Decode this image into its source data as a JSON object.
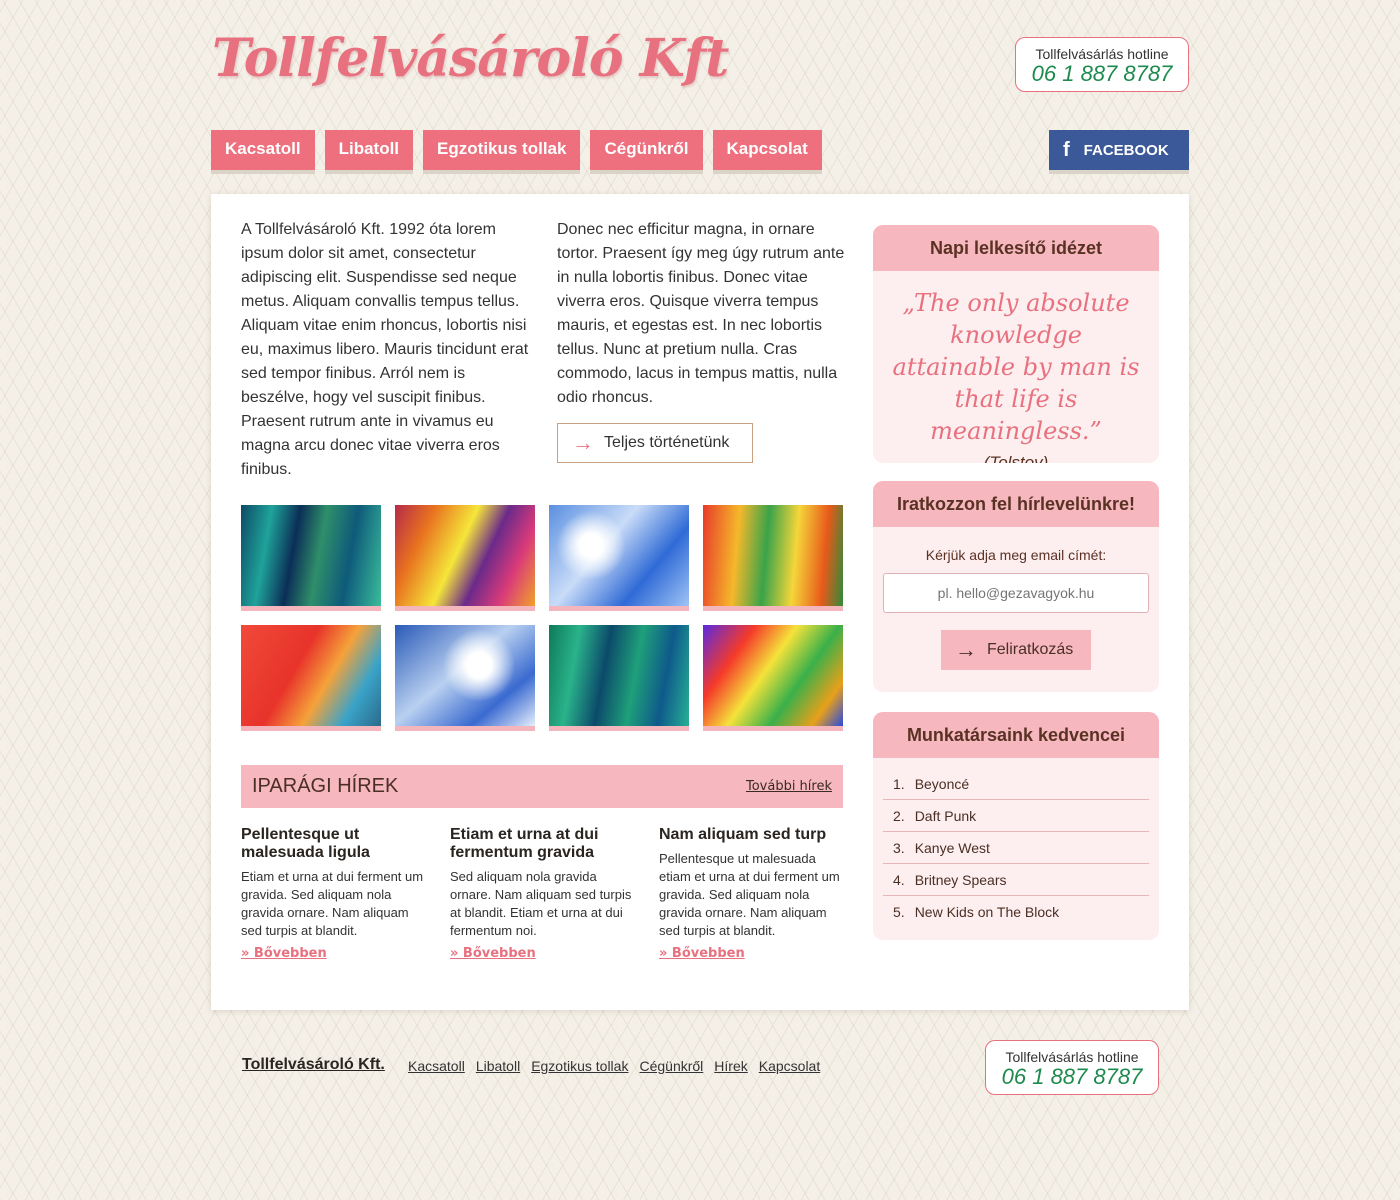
{
  "header": {
    "logo": "Tollfelvásároló Kft",
    "hotline_label": "Tollfelvásárlás hotline",
    "hotline_number": "06 1 887 8787"
  },
  "nav": [
    "Kacsatoll",
    "Libatoll",
    "Egzotikus tollak",
    "Cégünkről",
    "Kapcsolat"
  ],
  "facebook": {
    "icon": "facebook-icon",
    "label": "FACEBOOK",
    "color": "#3b5998"
  },
  "intro": {
    "col1": "A Tollfelvásároló Kft. 1992 óta lorem ipsum dolor sit amet, consectetur adipiscing elit. Suspendisse sed neque metus. Aliquam convallis tempus tellus. Aliquam vitae enim rhoncus, lobortis nisi eu, maximus libero. Mauris tincidunt erat sed tempor finibus. Arról nem is beszélve, hogy vel suscipit finibus. Praesent rutrum ante in vivamus eu magna arcu donec vitae viverra eros finibus.",
    "col2": "Donec nec efficitur magna, in ornare tortor. Praesent így meg úgy rutrum ante in nulla lobortis finibus. Donec vitae viverra eros. Quisque viverra tempus mauris, et egestas est. In nec lobortis tellus. Nunc at pretium nulla. Cras commodo, lacus in tempus mattis, nulla odio rhoncus.",
    "button": "Teljes történetünk"
  },
  "news_header": {
    "title": "IPARÁGI HÍREK",
    "more": "További hírek"
  },
  "news": [
    {
      "title": "Pellentesque ut malesuada ligula",
      "body": "Etiam et urna at dui ferment um gravida. Sed aliquam nola gravida ornare. Nam aliquam sed turpis at blandit.",
      "more": "» Bővebben"
    },
    {
      "title": "Etiam et urna at dui fermentum gravida",
      "body": "Sed aliquam nola gravida ornare. Nam aliquam sed turpis at blandit. Etiam et urna at dui fermentum noi.",
      "more": "» Bővebben"
    },
    {
      "title": "Nam aliquam sed turp",
      "body": "Pellentesque ut malesuada etiam et urna at dui ferment um gravida. Sed aliquam nola gravida ornare. Nam aliquam sed turpis at blandit.",
      "more": "» Bővebben"
    }
  ],
  "quote": {
    "title": "Napi lelkesítő idézet",
    "text": "„The only absolute knowledge attainable by man is that life is meaningless.”",
    "author": "(Tolstoy)"
  },
  "newsletter": {
    "title": "Iratkozzon fel hírlevelünkre!",
    "label": "Kérjük adja meg email címét:",
    "placeholder": "pl. hello@gezavagyok.hu",
    "button": "Feliratkozás"
  },
  "favorites": {
    "title": "Munkatársaink kedvencei",
    "items": [
      "Beyoncé",
      "Daft Punk",
      "Kanye West",
      "Britney Spears",
      "New Kids on The Block"
    ]
  },
  "footer": {
    "brand": "Tollfelvásároló Kft.",
    "links": [
      "Kacsatoll",
      "Libatoll",
      "Egzotikus tollak",
      "Cégünkről",
      "Hírek",
      "Kapcsolat"
    ]
  },
  "colors": {
    "accent": "#ee6f7d",
    "pink_light": "#f6b7bf",
    "hotline_green": "#1e8a4e"
  }
}
